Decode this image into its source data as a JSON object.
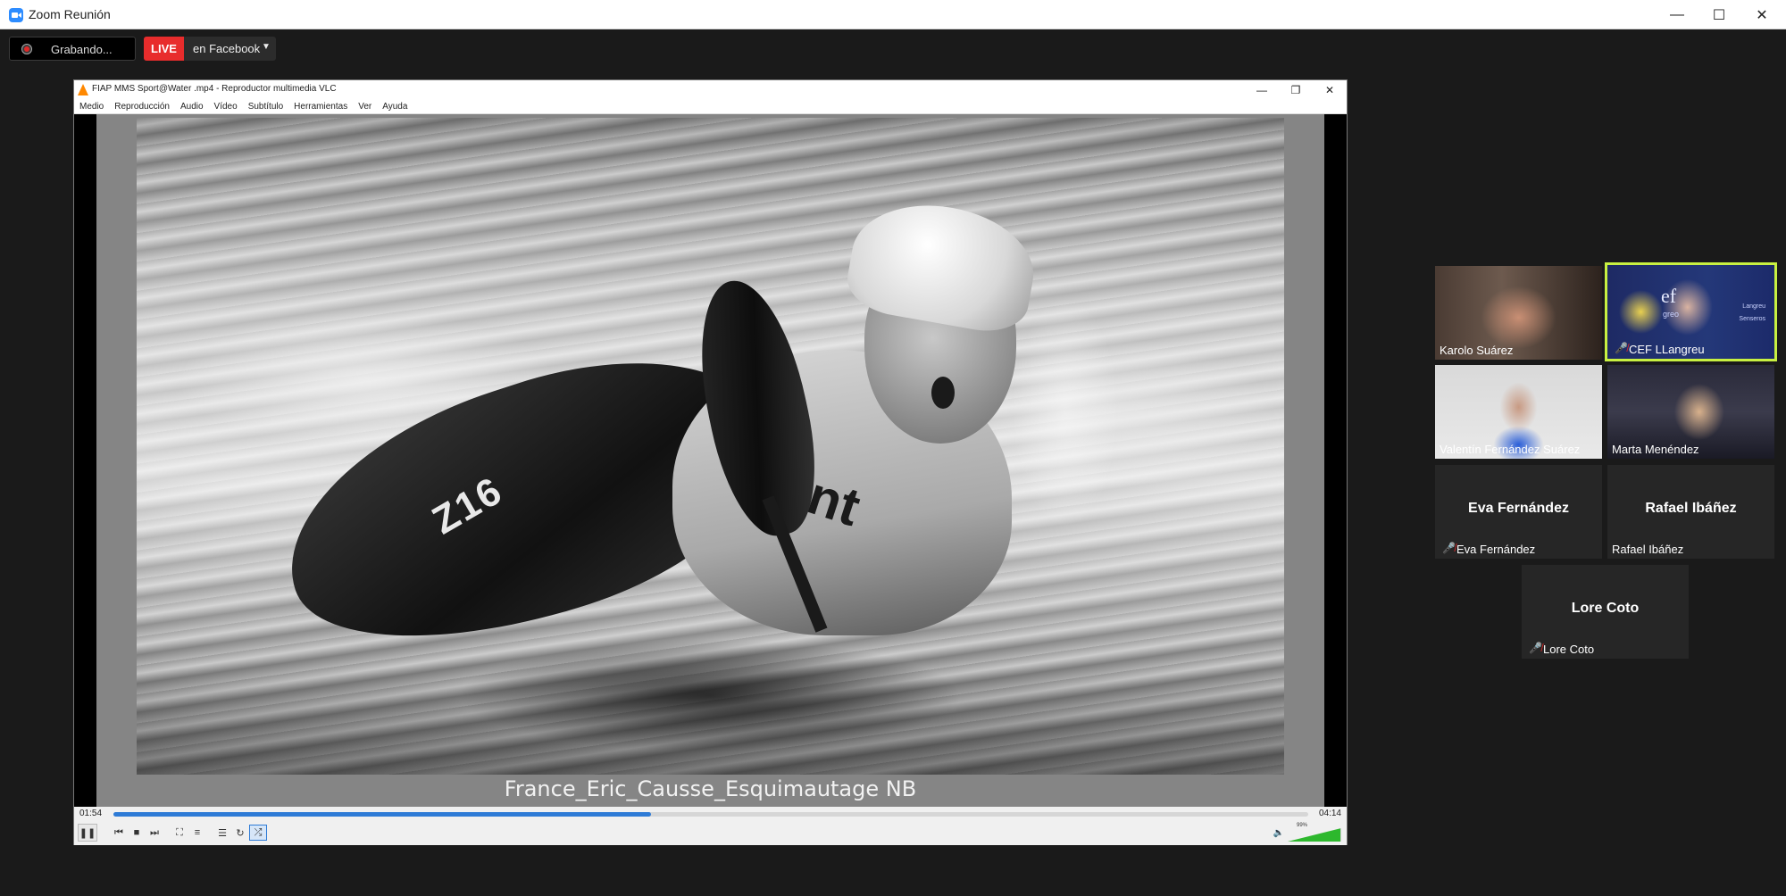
{
  "zoom": {
    "title": "Zoom Reunión",
    "recording_label": "Grabando...",
    "live_badge": "LIVE",
    "live_target": "en Facebook"
  },
  "vlc": {
    "title": "FIAP MMS Sport@Water .mp4 - Reproductor multimedia VLC",
    "menu": [
      "Medio",
      "Reproducción",
      "Audio",
      "Vídeo",
      "Subtítulo",
      "Herramientas",
      "Ver",
      "Ayuda"
    ],
    "caption": "France_Eric_Causse_Esquimautage NB",
    "photo_marks": {
      "kayak": "Z16",
      "bib": "ent"
    },
    "time_elapsed": "01:54",
    "time_total": "04:14",
    "progress": 0.45,
    "volume_label": "99%",
    "volume": 0.99,
    "accent_color": "#2e7bd6"
  },
  "participants": [
    {
      "name": "Karolo Suárez",
      "muted": false,
      "video": true
    },
    {
      "name": "CEF LLangreu",
      "muted": true,
      "video": true,
      "active": true,
      "bg_logo": "ef",
      "bg_sub": "greo",
      "bg_text": [
        "Langreu",
        "Senseros"
      ]
    },
    {
      "name": "Valentín Fernández Suárez",
      "muted": false,
      "video": true
    },
    {
      "name": "Marta Menéndez",
      "muted": false,
      "video": true
    },
    {
      "name": "Eva Fernández",
      "muted": true,
      "video": false,
      "display_name": "Eva Fernández"
    },
    {
      "name": "Rafael Ibáñez",
      "muted": false,
      "video": false,
      "display_name": "Rafael Ibáñez"
    },
    {
      "name": "Lore Coto",
      "muted": true,
      "video": false,
      "display_name": "Lore Coto"
    }
  ],
  "colors": {
    "active_speaker": "#c8f041",
    "live_red": "#e82c2c",
    "volume_green": "#2db82d"
  }
}
